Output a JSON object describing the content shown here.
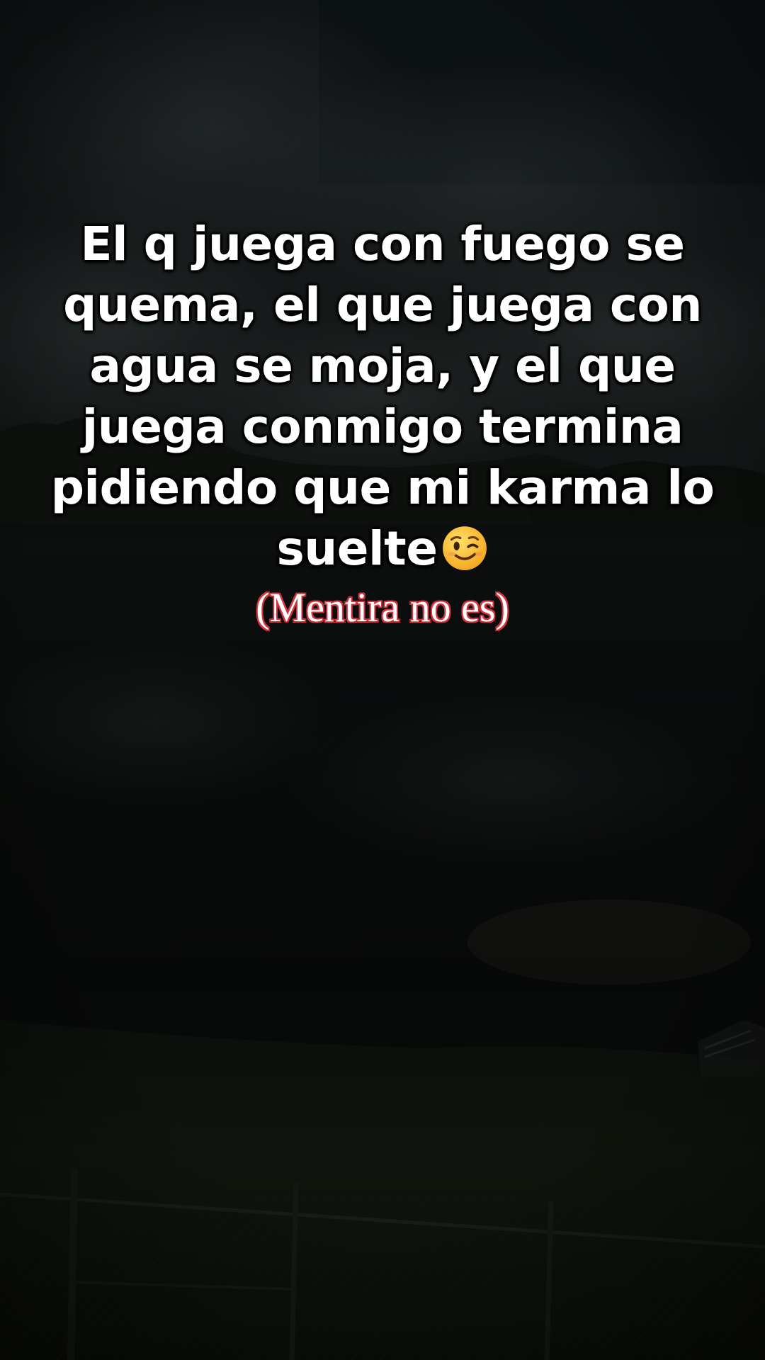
{
  "caption": {
    "main_text": "El q juega con fuego se quema, el que juega con agua se moja, y el que juega conmigo termina pidiendo que mi karma lo suelte",
    "emoji": "winking-face-icon",
    "sub_text": "(Mentira no es)"
  },
  "colors": {
    "caption_text": "#ffffff",
    "sub_outline": "#d1343e",
    "sky": "#1a1f1f",
    "water": "#0d100f",
    "grass": "#141a13"
  }
}
